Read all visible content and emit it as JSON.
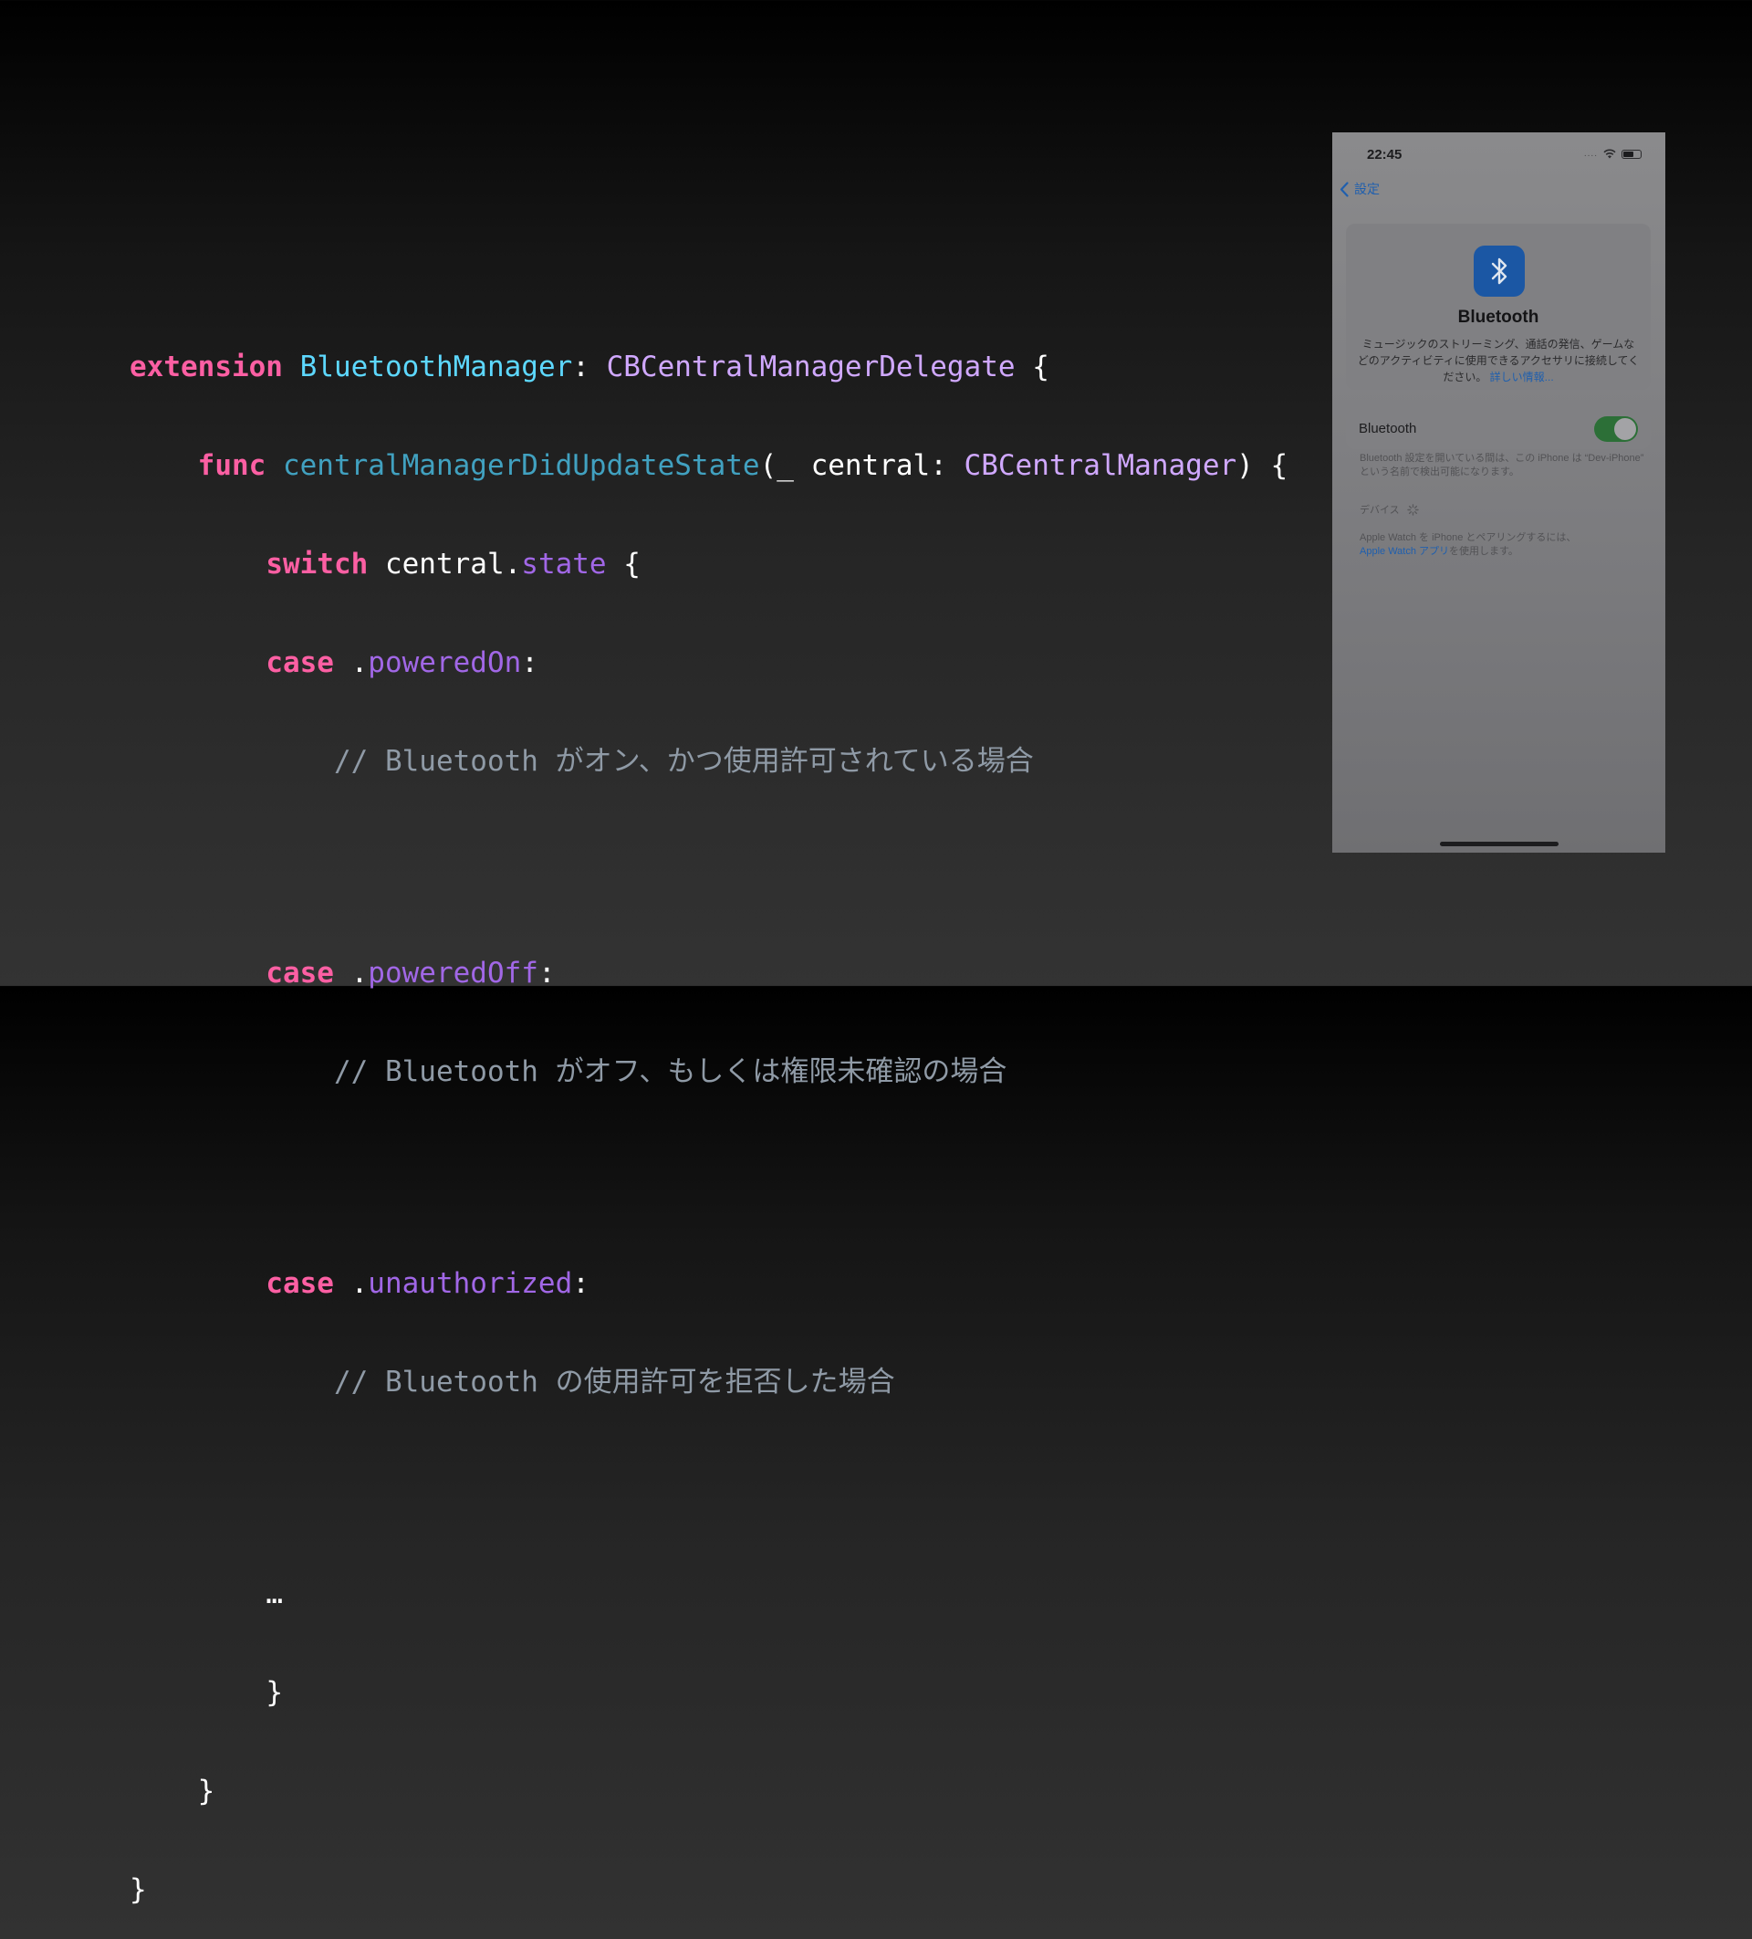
{
  "code": {
    "l1": {
      "kw": "extension",
      "sp": " ",
      "type": "BluetoothManager",
      "colon": ": ",
      "proto": "CBCentralManagerDelegate",
      "brace": " {"
    },
    "l2": {
      "indent": "    ",
      "kw": "func",
      "sp": " ",
      "name": "centralManagerDidUpdateState",
      "params_open": "(_ central: ",
      "param_type": "CBCentralManager",
      "params_close": ") {"
    },
    "l3": {
      "indent": "        ",
      "kw": "switch",
      "sp": " ",
      "subject": "central.",
      "member": "state",
      "brace": " {"
    },
    "l4": {
      "indent": "        ",
      "kw": "case",
      "dot": " .",
      "member": "poweredOn",
      "colon": ":"
    },
    "l5": {
      "indent": "            ",
      "comment": "// Bluetooth がオン、かつ使用許可されている場合"
    },
    "l6": {
      "indent": "        ",
      "kw": "case",
      "dot": " .",
      "member": "poweredOff",
      "colon": ":"
    },
    "l7": {
      "indent": "            ",
      "comment": "// Bluetooth がオフ、もしくは権限未確認の場合"
    },
    "l8": {
      "indent": "        ",
      "kw": "case",
      "dot": " .",
      "member": "unauthorized",
      "colon": ":"
    },
    "l9": {
      "indent": "            ",
      "comment": "// Bluetooth の使用許可を拒否した場合"
    },
    "l10": {
      "indent": "        ",
      "text": "…"
    },
    "l11": {
      "indent": "        ",
      "text": "}"
    },
    "l12": {
      "indent": "    ",
      "text": "}"
    },
    "l13": {
      "indent": "",
      "text": "}"
    }
  },
  "phone": {
    "status_time": "22:45",
    "status_signal": "....",
    "back_label": "設定",
    "card_title": "Bluetooth",
    "card_desc": "ミュージックのストリーミング、通話の発信、ゲームなどのアクティビティに使用できるアクセサリに接続してください。",
    "card_link": "詳しい情報...",
    "toggle_label": "Bluetooth",
    "toggle_on": true,
    "footnote": "Bluetooth 設定を開いている間は、この iPhone は “Dev-iPhone” という名前で検出可能になります。",
    "devices_header": "デバイス",
    "pair_note_1": "Apple Watch を iPhone とペアリングするには、",
    "pair_link": "Apple Watch アプリ",
    "pair_note_2": "を使用します。",
    "accent": "#1f5fae",
    "toggle_color": "#2c6f37",
    "icons": [
      "wifi-icon",
      "battery-icon",
      "chevron-left-icon",
      "bluetooth-icon",
      "spinner-icon"
    ]
  }
}
